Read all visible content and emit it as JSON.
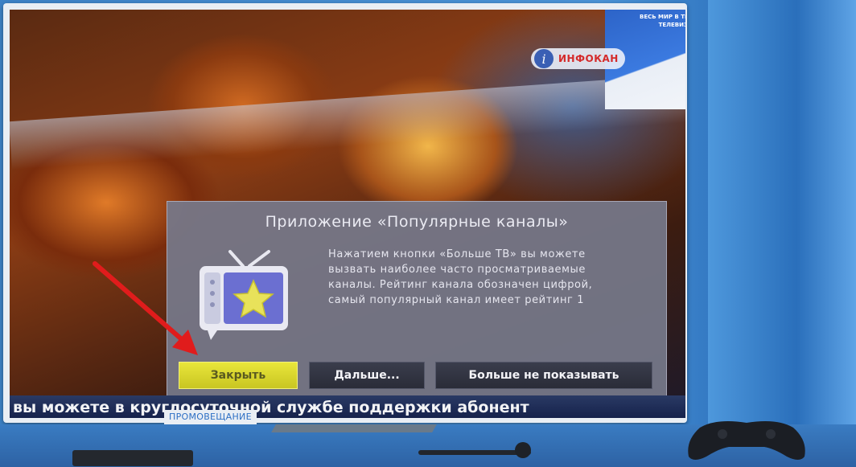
{
  "dialog": {
    "title": "Приложение «Популярные каналы»",
    "body": "Нажатием кнопки «Больше ТВ» вы можете вызвать наиболее часто просматриваемые каналы. Рейтинг канала обозначен цифрой, самый популярный канал имеет рейтинг 1",
    "buttons": {
      "close": "Закрыть",
      "next": "Дальше...",
      "never_show": "Больше не показывать"
    }
  },
  "ticker": {
    "text": "вы можете в круглосуточной службе поддержки абонент"
  },
  "channel_logo": {
    "letter": "i",
    "name": "ИНФОКАН"
  },
  "promo_poster": {
    "text": "ВЕСЬ МИР В ТВОЕМ ТЕЛЕВИЗОРЕ!"
  },
  "promo_label": "ПРОМОВЕЩАНИЕ",
  "colors": {
    "selected_button": "#e9e63a",
    "dialog_bg": "#76788a",
    "arrow": "#e01c1c"
  },
  "icons": {
    "dialog_illustration": "tv-star-icon",
    "arrow": "red-arrow-annotation"
  }
}
